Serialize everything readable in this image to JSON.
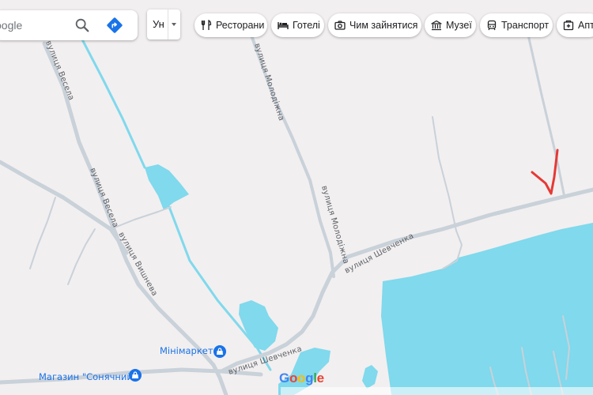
{
  "search": {
    "visible_text": "oogle"
  },
  "language": {
    "label": "Ун"
  },
  "chips": [
    {
      "label": "Ресторани",
      "icon": "restaurant-icon"
    },
    {
      "label": "Готелі",
      "icon": "hotel-icon"
    },
    {
      "label": "Чим зайнятися",
      "icon": "camera-icon"
    },
    {
      "label": "Музеї",
      "icon": "museum-icon"
    },
    {
      "label": "Транспорт",
      "icon": "transit-icon"
    },
    {
      "label": "Апте",
      "icon": "pharmacy-icon"
    }
  ],
  "map": {
    "streets": {
      "vesela_top": "вулиця Весела",
      "vesela": "вулиця Весела",
      "molodizhna_top": "вулиця Молодіжна",
      "molodizhna": "вулиця Молодіжна",
      "vyshneva": "вулиця Вишнева",
      "shevchenka_right": "вулиця Шевченка",
      "shevchenka_left": "вулиця Шевченка"
    },
    "pois": {
      "minimarket": "Мінімаркет",
      "sonyachnyi": "Магазин \"Сонячний\""
    },
    "colors": {
      "water": "#80d9ec",
      "road": "#c9d1d9",
      "land": "#f2eff0",
      "poi": "#1a73e8",
      "annotation": "#e53935"
    }
  },
  "branding": {
    "google": "Google"
  }
}
